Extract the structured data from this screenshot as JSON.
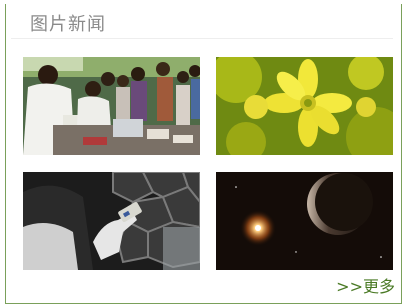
{
  "panel": {
    "title": "图片新闻",
    "more_label": ">>更多",
    "border_color": "#7aa05a",
    "title_color": "#8a8a8a",
    "more_color": "#4a7a25"
  },
  "thumbnails": [
    {
      "subject": "medical-lab-with-crowd"
    },
    {
      "subject": "yellow-flower-closeup"
    },
    {
      "subject": "gloved-hand-holding-sample"
    },
    {
      "subject": "dark-planet-and-star"
    }
  ]
}
